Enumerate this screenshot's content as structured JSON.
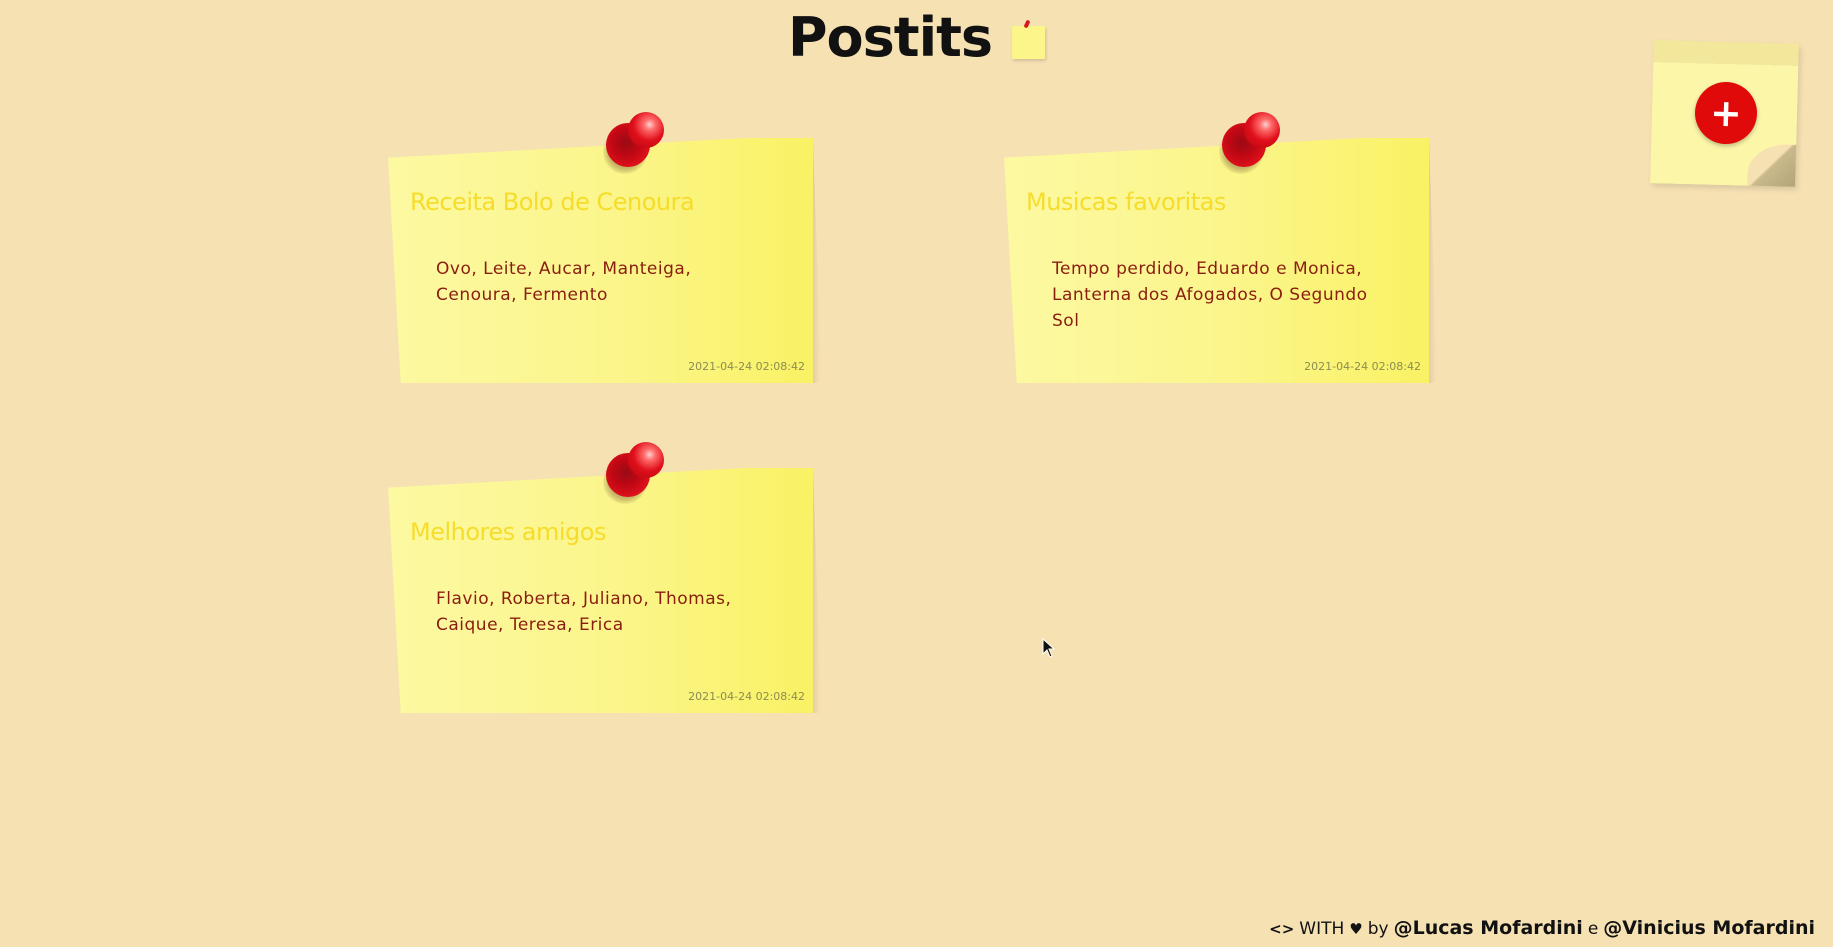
{
  "header": {
    "title": "Postits",
    "logo_icon": "sticky-note-icon"
  },
  "add_button": {
    "icon": "plus-icon",
    "label": "+"
  },
  "notes": [
    {
      "title": "Receita Bolo de Cenoura",
      "body": "Ovo, Leite, Aucar, Manteiga, Cenoura, Fermento",
      "date": "2021-04-24 02:08:42"
    },
    {
      "title": "Musicas favoritas",
      "body": "Tempo perdido, Eduardo e Monica, Lanterna dos Afogados, O Segundo Sol",
      "date": "2021-04-24 02:08:42"
    },
    {
      "title": "Melhores amigos",
      "body": "Flavio, Roberta, Juliano, Thomas, Caique, Teresa, Erica",
      "date": "2021-04-24 02:08:42"
    }
  ],
  "footer": {
    "code_symbol": "<>",
    "with_text": "WITH",
    "heart_symbol": "♥",
    "by_text": "by",
    "author_1": "@Lucas Mofardini",
    "and_text": "e",
    "author_2": "@Vinicius Mofardini"
  },
  "colors": {
    "background": "#f6e1b3",
    "note_yellow": "#fbf58a",
    "note_title": "#f6dc2b",
    "note_body": "#8a1d10",
    "pin_red": "#e10a0a"
  }
}
